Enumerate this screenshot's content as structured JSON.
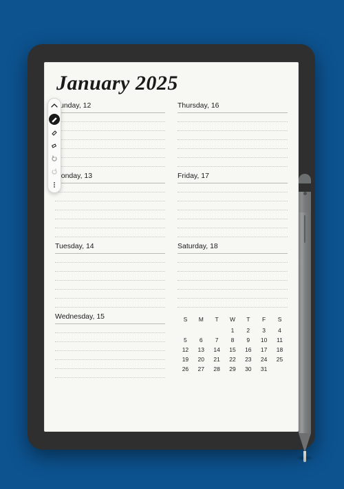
{
  "title": "January 2025",
  "days": [
    {
      "label": "Sunday, 12"
    },
    {
      "label": "Thursday, 16"
    },
    {
      "label": "Monday, 13"
    },
    {
      "label": "Friday, 17"
    },
    {
      "label": "Tuesday, 14"
    },
    {
      "label": "Saturday, 18"
    },
    {
      "label": "Wednesday, 15"
    }
  ],
  "ruled_lines_per_day": 6,
  "toolbar": {
    "items": [
      {
        "name": "collapse",
        "active": false
      },
      {
        "name": "pen",
        "active": true
      },
      {
        "name": "highlighter",
        "active": false
      },
      {
        "name": "eraser",
        "active": false
      },
      {
        "name": "undo",
        "active": false
      },
      {
        "name": "redo",
        "active": false
      },
      {
        "name": "more",
        "active": false
      }
    ]
  },
  "calendar": {
    "weekday_headers": [
      "S",
      "M",
      "T",
      "W",
      "T",
      "F",
      "S"
    ],
    "rows": [
      [
        "",
        "",
        "",
        "1",
        "2",
        "3",
        "4"
      ],
      [
        "5",
        "6",
        "7",
        "8",
        "9",
        "10",
        "11"
      ],
      [
        "12",
        "13",
        "14",
        "15",
        "16",
        "17",
        "18"
      ],
      [
        "19",
        "20",
        "21",
        "22",
        "23",
        "24",
        "25"
      ],
      [
        "26",
        "27",
        "28",
        "29",
        "30",
        "31",
        ""
      ]
    ]
  },
  "icons": {
    "collapse": "chevron-up-icon",
    "pen": "pen-icon",
    "highlighter": "highlighter-icon",
    "eraser": "eraser-icon",
    "undo": "undo-icon",
    "redo": "redo-icon",
    "more": "more-vertical-icon"
  }
}
